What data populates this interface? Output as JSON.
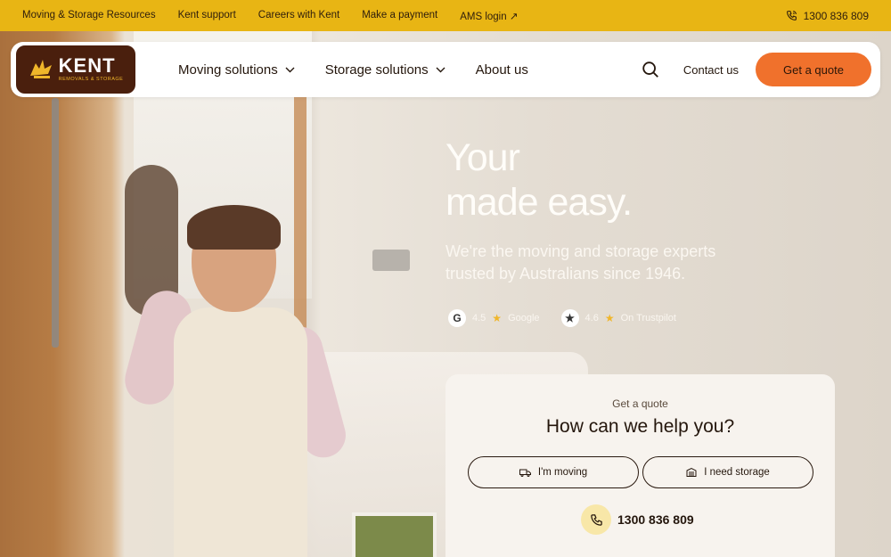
{
  "topbar": {
    "links": [
      "Moving & Storage Resources",
      "Kent support",
      "Careers with Kent",
      "Make a payment",
      "AMS login"
    ],
    "ams_arrow": "↗",
    "phone": "1300 836 809"
  },
  "nav": {
    "logo_text": "KENT",
    "logo_sub": "REMOVALS & STORAGE",
    "menu": [
      "Moving solutions",
      "Storage solutions",
      "About us"
    ],
    "contact": "Contact us",
    "cta": "Get a quote"
  },
  "hero": {
    "headline_line1": "Your",
    "headline_line2": "made easy.",
    "subtext": "We're the moving and storage experts trusted by Australians since 1946.",
    "ratings": [
      {
        "badge": "G",
        "score": "4.5",
        "source": "Google"
      },
      {
        "badge": "★",
        "score": "4.6",
        "source": "On Trustpilot"
      }
    ]
  },
  "quote_card": {
    "label": "Get a quote",
    "title": "How can we help you?",
    "moving_button": "I'm moving",
    "storage_button": "I need storage",
    "phone": "1300 836 809"
  },
  "colors": {
    "topbar": "#e8b514",
    "cta": "#f0712c",
    "logo_bg": "#4a1f0d",
    "star": "#f0b62a"
  }
}
